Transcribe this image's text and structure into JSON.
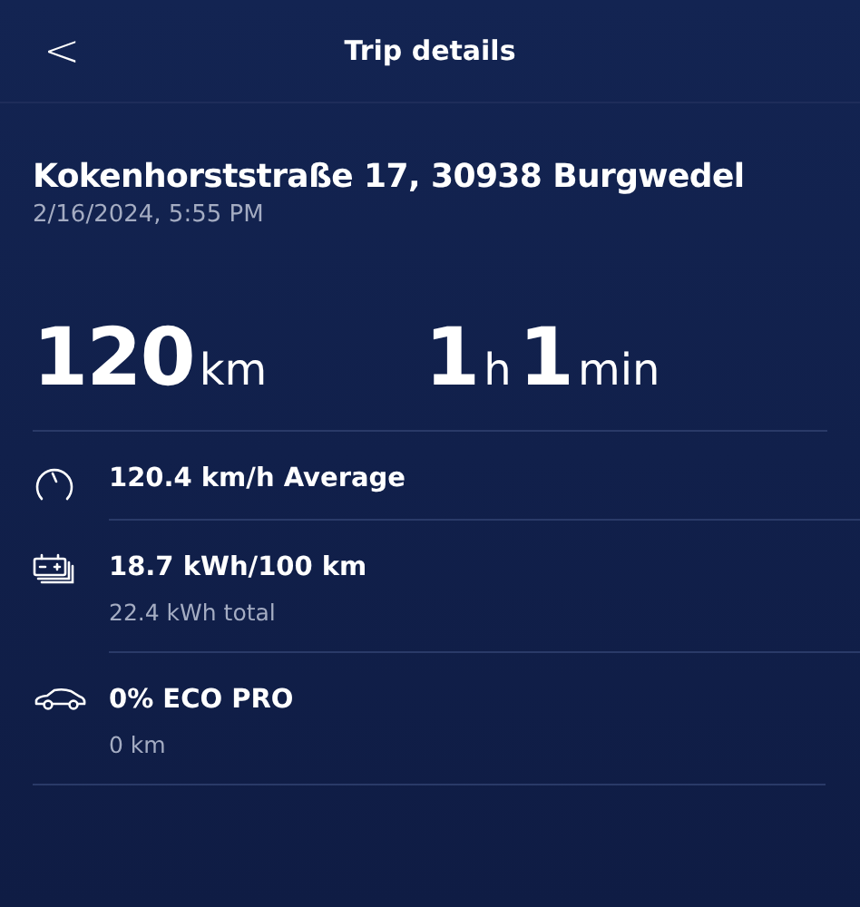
{
  "header": {
    "back": "<",
    "title": "Trip details"
  },
  "trip": {
    "address": "Kokenhorststraße 17, 30938 Burgwedel",
    "datetime": "2/16/2024, 5:55 PM"
  },
  "stats": [
    {
      "parts": [
        {
          "value": "120",
          "unit": "km"
        }
      ]
    },
    {
      "parts": [
        {
          "value": "1",
          "unit": "h"
        },
        {
          "value": "1",
          "unit": "min"
        }
      ]
    }
  ],
  "details": [
    {
      "kind": "speedometer",
      "title": "120.4 km/h Average"
    },
    {
      "kind": "battery",
      "title": "18.7 kWh/100 km",
      "subtitle": "22.4 kWh total"
    },
    {
      "kind": "car",
      "title": "0% ECO PRO",
      "subtitle": "0 km"
    }
  ]
}
